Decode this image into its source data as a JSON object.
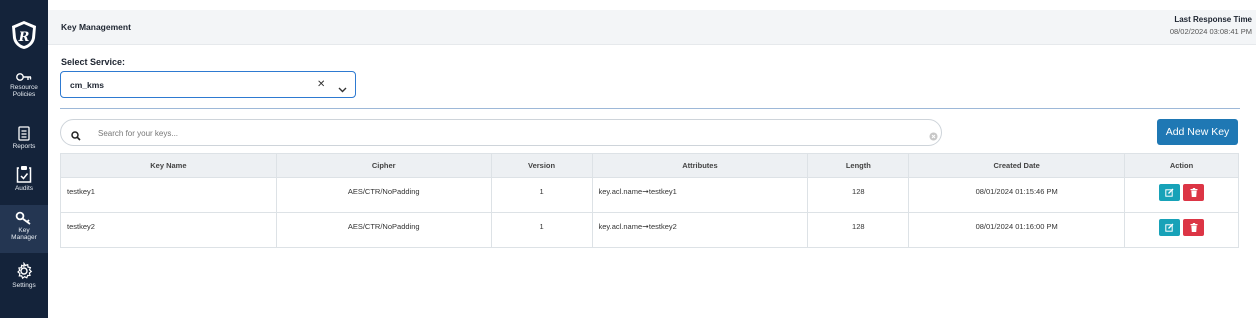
{
  "header": {
    "title": "Key Management",
    "last_response_label": "Last Response Time",
    "last_response_value": "08/02/2024 03:08:41 PM"
  },
  "sidebar": {
    "items": [
      {
        "label_line1": "Resource",
        "label_line2": "Policies",
        "icon": "key-icon"
      },
      {
        "label_line1": "Reports",
        "label_line2": "",
        "icon": "report-icon"
      },
      {
        "label_line1": "Audits",
        "label_line2": "",
        "icon": "clipboard-icon"
      },
      {
        "label_line1": "Key",
        "label_line2": "Manager",
        "icon": "key-search-icon"
      },
      {
        "label_line1": "Settings",
        "label_line2": "",
        "icon": "gear-icon"
      }
    ]
  },
  "service": {
    "label": "Select Service:",
    "value": "cm_kms"
  },
  "search": {
    "placeholder": "Search for your keys..."
  },
  "add_button": "Add New Key",
  "table": {
    "headers": [
      "Key Name",
      "Cipher",
      "Version",
      "Attributes",
      "Length",
      "Created Date",
      "Action"
    ],
    "rows": [
      {
        "name": "testkey1",
        "cipher": "AES/CTR/NoPadding",
        "version": "1",
        "attr_key": "key.acl.name",
        "attr_arrow": "➞",
        "attr_value": "testkey1",
        "length": "128",
        "created": "08/01/2024 01:15:46 PM"
      },
      {
        "name": "testkey2",
        "cipher": "AES/CTR/NoPadding",
        "version": "1",
        "attr_key": "key.acl.name",
        "attr_arrow": "➞",
        "attr_value": "testkey2",
        "length": "128",
        "created": "08/01/2024 01:16:00 PM"
      }
    ]
  },
  "colors": {
    "sidebar": "#14233a",
    "primary": "#1f78b4",
    "edit": "#17a2b8",
    "delete": "#dc3545"
  }
}
